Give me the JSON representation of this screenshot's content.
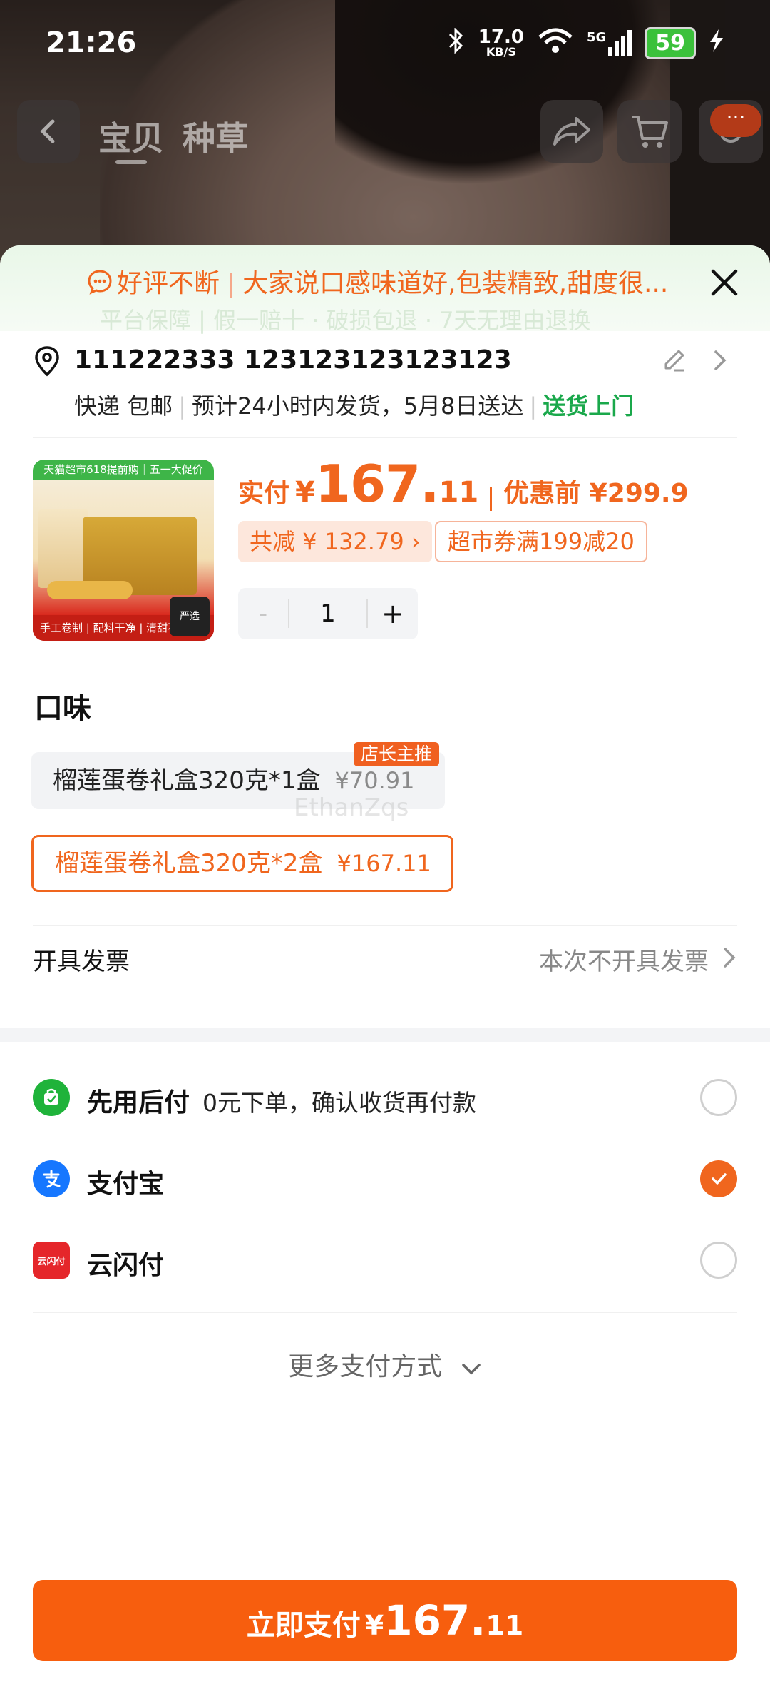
{
  "status_bar": {
    "time": "21:26",
    "net_speed_value": "17.0",
    "net_speed_unit": "KB/S",
    "network": "5G",
    "battery": "59"
  },
  "top_nav": {
    "tabs": [
      "宝贝",
      "种草"
    ],
    "message_badge": "···"
  },
  "banner": {
    "review_label": "好评不断",
    "review_text": "大家说口感味道好,包装精致,甜度很...",
    "guarantee": "平台保障 | 假一赔十 · 破损包退 · 7天无理由退换"
  },
  "address": {
    "line1": "111222333 123123123123123",
    "shipping": "快递 包邮",
    "eta": "预计24小时内发货，5月8日送达",
    "delivery": "送货上门"
  },
  "product": {
    "image_header": "天猫超市618提前购｜五一大促价",
    "image_footer": "手工卷制 | 配料干净 | 清甜不腻",
    "image_tag": "严选",
    "paid_label": "实付",
    "currency": "¥",
    "paid_int": "167.",
    "paid_dec": "11",
    "pre_discount": "优惠前 ¥299.9",
    "savings_chip": "共减 ¥ 132.79 ›",
    "coupon_chip": "超市券满199减20",
    "quantity": "1",
    "minus": "-",
    "plus": "+"
  },
  "flavor": {
    "title": "口味",
    "recommend_tag": "店长主推",
    "options": [
      {
        "label": "榴莲蛋卷礼盒320克*1盒",
        "price": "¥70.91",
        "selected": false
      },
      {
        "label": "榴莲蛋卷礼盒320克*2盒",
        "price": "¥167.11",
        "selected": true
      }
    ],
    "watermark": "EthanZqs"
  },
  "invoice": {
    "label": "开具发票",
    "value": "本次不开具发票"
  },
  "payment": {
    "methods": [
      {
        "name": "先用后付",
        "desc": "0元下单，确认收货再付款",
        "icon": "pay-later-icon",
        "color": "#1fb33a",
        "selected": false
      },
      {
        "name": "支付宝",
        "desc": "",
        "icon": "alipay-icon",
        "color": "#1677ff",
        "selected": true
      },
      {
        "name": "云闪付",
        "desc": "",
        "icon": "unionpay-icon",
        "color": "#e5262a",
        "icon_text": "云闪付",
        "selected": false
      }
    ],
    "more": "更多支付方式"
  },
  "pay_button": {
    "label": "立即支付",
    "currency": "¥",
    "int": "167.",
    "dec": "11"
  },
  "colors": {
    "accent": "#f0661e",
    "green": "#1aa84b"
  }
}
